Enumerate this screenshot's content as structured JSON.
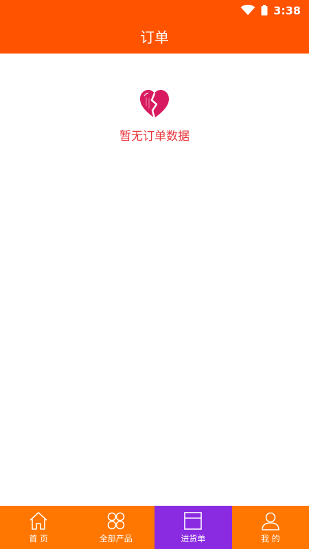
{
  "status_bar": {
    "time": "3:38",
    "icons": [
      "wifi-icon",
      "battery-icon"
    ]
  },
  "header": {
    "title": "订单"
  },
  "empty_state": {
    "icon": "broken-heart-icon",
    "message": "暂无订单数据"
  },
  "tabs": [
    {
      "label": "首 页",
      "icon": "home-icon",
      "active": false
    },
    {
      "label": "全部产品",
      "icon": "grid-icon",
      "active": false
    },
    {
      "label": "进货单",
      "icon": "cart-list-icon",
      "active": true
    },
    {
      "label": "我 的",
      "icon": "user-icon",
      "active": false
    }
  ],
  "colors": {
    "header": "#ff5300",
    "tabbar": "#ff7600",
    "active_tab": "#8a2be2",
    "empty_text": "#e8353a",
    "heart": "#d81b60"
  }
}
